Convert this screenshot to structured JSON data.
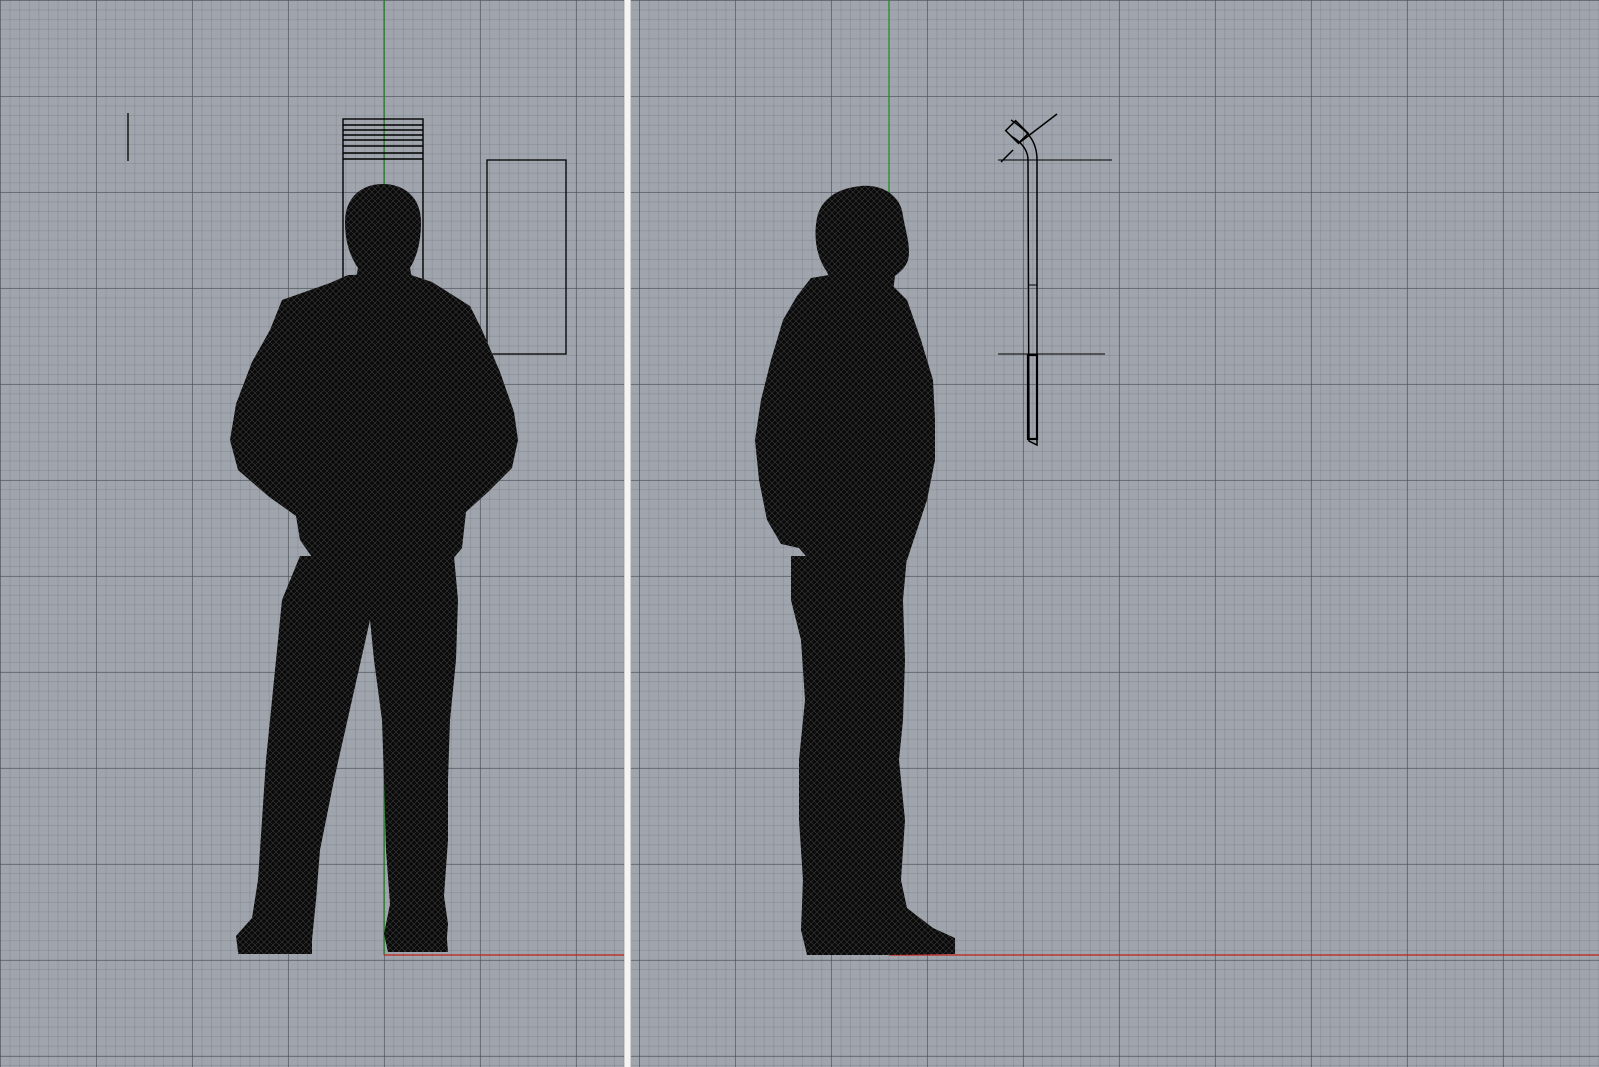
{
  "viewports": [
    {
      "id": "front",
      "label": "",
      "axes": {
        "x_color": "#c0201a",
        "y_color": "#1e8a1e"
      }
    },
    {
      "id": "right",
      "label": "",
      "axes": {
        "x_color": "#c0201a",
        "y_color": "#1e8a1e"
      }
    }
  ],
  "colors": {
    "background": "#a0a5ad",
    "grid_major": "#484c54",
    "grid_minor": "#5a5f68",
    "geometry": "#000000",
    "divider": "#f4f4f4"
  },
  "objects": {
    "front": [
      "human-figure-back-view",
      "vertical-line",
      "stacked-rectangle",
      "outline-rectangle"
    ],
    "right": [
      "human-figure-side-view",
      "bent-rod-profile"
    ]
  }
}
